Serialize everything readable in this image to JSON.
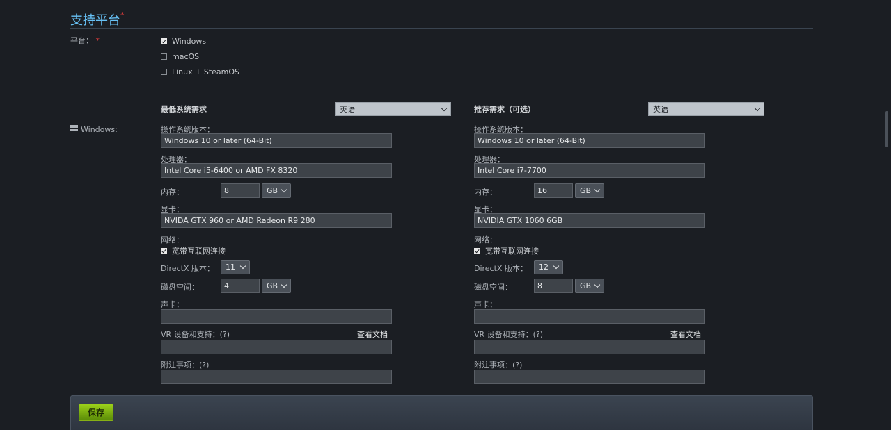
{
  "section": {
    "title": "支持平台",
    "required_mark": "*"
  },
  "platforms": {
    "label": "平台：",
    "required_mark": "*",
    "items": [
      {
        "label": "Windows",
        "checked": true
      },
      {
        "label": "macOS",
        "checked": false
      },
      {
        "label": "Linux + SteamOS",
        "checked": false
      }
    ]
  },
  "windows_row_label": "Windows:",
  "minimum": {
    "heading": "最低系统需求",
    "language": "英语",
    "os_label": "操作系统版本：",
    "os_value": "Windows 10 or later (64-Bit)",
    "cpu_label": "处理器：",
    "cpu_value": "Intel Core i5-6400 or AMD FX 8320",
    "memory_label": "内存：",
    "memory_value": "8",
    "memory_unit": "GB",
    "gpu_label": "显卡：",
    "gpu_value": "NVIDA GTX 960 or AMD Radeon R9 280",
    "network_label": "网络：",
    "network_option": "宽带互联网连接",
    "network_checked": true,
    "directx_label": "DirectX 版本：",
    "directx_value": "11",
    "disk_label": "磁盘空间：",
    "disk_value": "4",
    "disk_unit": "GB",
    "sound_label": "声卡：",
    "sound_value": "",
    "vr_label": "VR 设备和支持：(?)",
    "vr_link": "查看文档",
    "vr_value": "",
    "notes_label": "附注事项：(?)",
    "notes_value": ""
  },
  "recommended": {
    "heading": "推荐需求（可选）",
    "language": "英语",
    "os_label": "操作系统版本：",
    "os_value": "Windows 10 or later (64-Bit)",
    "cpu_label": "处理器：",
    "cpu_value": "Intel Core i7-7700",
    "memory_label": "内存：",
    "memory_value": "16",
    "memory_unit": "GB",
    "gpu_label": "显卡：",
    "gpu_value": "NVIDIA GTX 1060 6GB",
    "network_label": "网络：",
    "network_option": "宽带互联网连接",
    "network_checked": true,
    "directx_label": "DirectX 版本：",
    "directx_value": "12",
    "disk_label": "磁盘空间：",
    "disk_value": "8",
    "disk_unit": "GB",
    "sound_label": "声卡：",
    "sound_value": "",
    "vr_label": "VR 设备和支持：(?)",
    "vr_link": "查看文档",
    "vr_value": "",
    "notes_label": "附注事项：(?)",
    "notes_value": ""
  },
  "footer": {
    "save_label": "保存"
  },
  "colors": {
    "accent": "#67c1f5",
    "required": "#d43a3a",
    "save_button": "#7fb51a"
  }
}
